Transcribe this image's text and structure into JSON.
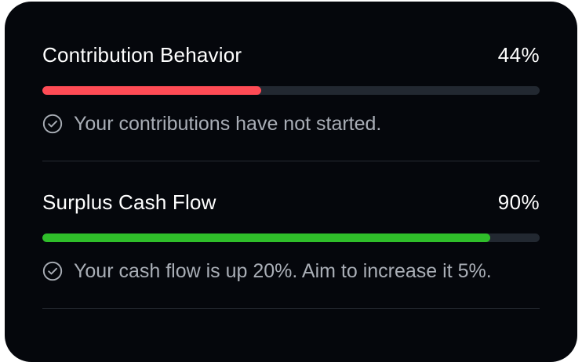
{
  "metrics": [
    {
      "title": "Contribution Behavior",
      "percent_label": "44%",
      "progress": 0.44,
      "bar_color": "#ff4b55",
      "note_icon": "check-circle-icon",
      "note": "Your contributions have not started."
    },
    {
      "title": "Surplus Cash Flow",
      "percent_label": "90%",
      "progress": 0.9,
      "bar_color": "#2fbe2a",
      "note_icon": "check-circle-icon",
      "note": "Your cash flow is up 20%. Aim to increase it 5%."
    }
  ],
  "colors": {
    "card_background": "#05070c",
    "track": "#222831",
    "divider": "#262b33",
    "muted_text": "#a9aeb6"
  }
}
